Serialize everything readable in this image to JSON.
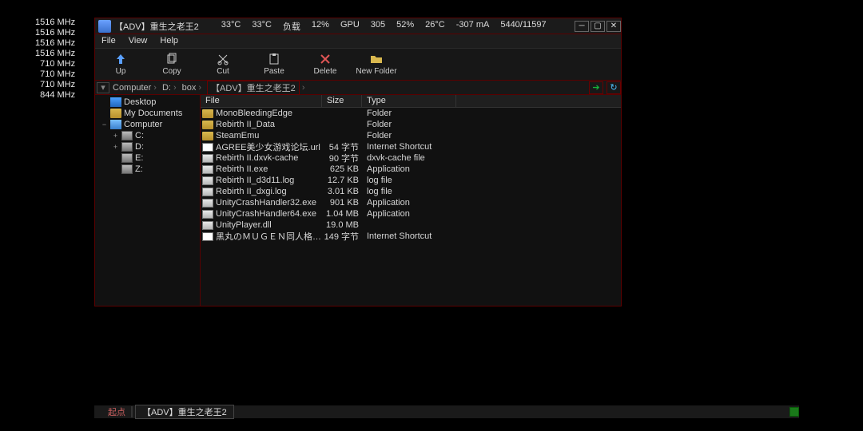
{
  "clocks": [
    "1516 MHz",
    "1516 MHz",
    "1516 MHz",
    "1516 MHz",
    "710 MHz",
    "710 MHz",
    "710 MHz",
    "844 MHz"
  ],
  "caption": {
    "title": "【ADV】重生之老王2",
    "stats": [
      "33°C",
      "33°C",
      "负载",
      "12%",
      "GPU",
      "305",
      "52%",
      "26°C",
      "-307 mA",
      "5440/11597"
    ]
  },
  "menu": [
    "File",
    "View",
    "Help"
  ],
  "toolbar": [
    {
      "name": "up",
      "label": "Up"
    },
    {
      "name": "copy",
      "label": "Copy"
    },
    {
      "name": "cut",
      "label": "Cut"
    },
    {
      "name": "paste",
      "label": "Paste"
    },
    {
      "name": "delete",
      "label": "Delete"
    },
    {
      "name": "newfolder",
      "label": "New Folder"
    }
  ],
  "breadcrumbs": [
    "Computer",
    "D:",
    "box",
    "【ADV】重生之老王2"
  ],
  "tree": [
    {
      "level": 1,
      "icon": "desktop",
      "label": "Desktop",
      "expander": ""
    },
    {
      "level": 1,
      "icon": "folder",
      "label": "My Documents",
      "expander": ""
    },
    {
      "level": 1,
      "icon": "comp",
      "label": "Computer",
      "expander": "−"
    },
    {
      "level": 2,
      "icon": "drive",
      "label": "C:",
      "expander": "+"
    },
    {
      "level": 2,
      "icon": "drive",
      "label": "D:",
      "expander": "+"
    },
    {
      "level": 2,
      "icon": "drive",
      "label": "E:",
      "expander": ""
    },
    {
      "level": 2,
      "icon": "drive",
      "label": "Z:",
      "expander": ""
    }
  ],
  "columns": {
    "file": "File",
    "size": "Size",
    "type": "Type"
  },
  "rows": [
    {
      "icon": "folder",
      "name": "MonoBleedingEdge",
      "size": "",
      "type": "Folder"
    },
    {
      "icon": "folder",
      "name": "Rebirth II_Data",
      "size": "",
      "type": "Folder"
    },
    {
      "icon": "folder",
      "name": "SteamEmu",
      "size": "",
      "type": "Folder"
    },
    {
      "icon": "url",
      "name": "AGREE美少女游戏论坛.url",
      "size": "54 字节",
      "type": "Internet Shortcut"
    },
    {
      "icon": "file",
      "name": "Rebirth II.dxvk-cache",
      "size": "90 字节",
      "type": "dxvk-cache file"
    },
    {
      "icon": "exe",
      "name": "Rebirth II.exe",
      "size": "625 KB",
      "type": "Application"
    },
    {
      "icon": "file",
      "name": "Rebirth II_d3d11.log",
      "size": "12.7 KB",
      "type": "log file"
    },
    {
      "icon": "file",
      "name": "Rebirth II_dxgi.log",
      "size": "3.01 KB",
      "type": "log file"
    },
    {
      "icon": "exe",
      "name": "UnityCrashHandler32.exe",
      "size": "901 KB",
      "type": "Application"
    },
    {
      "icon": "exe",
      "name": "UnityCrashHandler64.exe",
      "size": "1.04 MB",
      "type": "Application"
    },
    {
      "icon": "file",
      "name": "UnityPlayer.dll",
      "size": "19.0 MB",
      "type": ""
    },
    {
      "icon": "url",
      "name": "黑丸のＭＵＧＥＮ同人格斗园....",
      "size": "149 字节",
      "type": "Internet Shortcut"
    }
  ],
  "taskbar": {
    "start": "起点",
    "task": "【ADV】重生之老王2"
  }
}
